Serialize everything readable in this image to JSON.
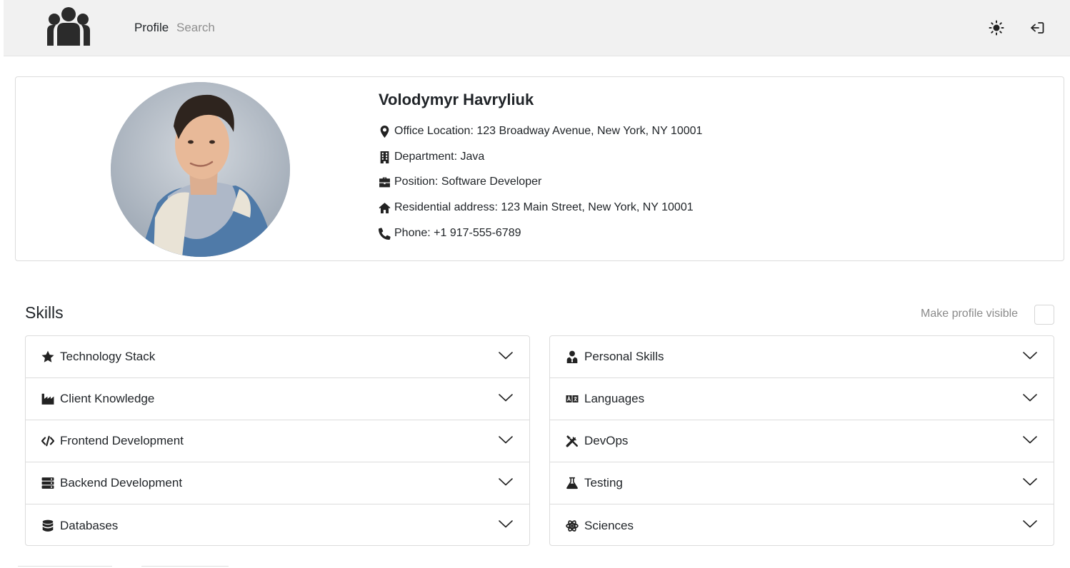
{
  "header": {
    "logo_icon": "users-group-icon",
    "nav_profile_label": "Profile",
    "search_placeholder": "Search",
    "theme_icon": "sun-icon",
    "logout_icon": "sign-out-icon"
  },
  "profile": {
    "name": "Volodymyr Havryliuk",
    "avatar_icon": "user-photo",
    "details": [
      {
        "icon": "map-marker-icon",
        "text": "Office Location: 123 Broadway Avenue, New York, NY 10001"
      },
      {
        "icon": "building-icon",
        "text": "Department: Java"
      },
      {
        "icon": "briefcase-icon",
        "text": "Position: Software Developer"
      },
      {
        "icon": "home-icon",
        "text": "Residential address: 123 Main Street, New York, NY 10001"
      },
      {
        "icon": "phone-icon",
        "text": "Phone: +1 917-555-6789"
      }
    ]
  },
  "skills": {
    "title": "Skills",
    "visibility_label": "Make profile visible",
    "visibility_checked": false,
    "left_categories": [
      {
        "icon": "star-icon",
        "label": "Technology Stack"
      },
      {
        "icon": "industry-icon",
        "label": "Client Knowledge"
      },
      {
        "icon": "code-icon",
        "label": "Frontend Development"
      },
      {
        "icon": "server-icon",
        "label": "Backend Development"
      },
      {
        "icon": "database-icon",
        "label": "Databases"
      }
    ],
    "right_categories": [
      {
        "icon": "user-tie-icon",
        "label": "Personal Skills"
      },
      {
        "icon": "language-icon",
        "label": "Languages"
      },
      {
        "icon": "tools-icon",
        "label": "DevOps"
      },
      {
        "icon": "flask-icon",
        "label": "Testing"
      },
      {
        "icon": "atom-icon",
        "label": "Sciences"
      }
    ]
  },
  "colors": {
    "header_bg": "#f1f1f1",
    "text": "#212529",
    "muted": "#8a8a8a",
    "border": "#dcdcdc"
  }
}
